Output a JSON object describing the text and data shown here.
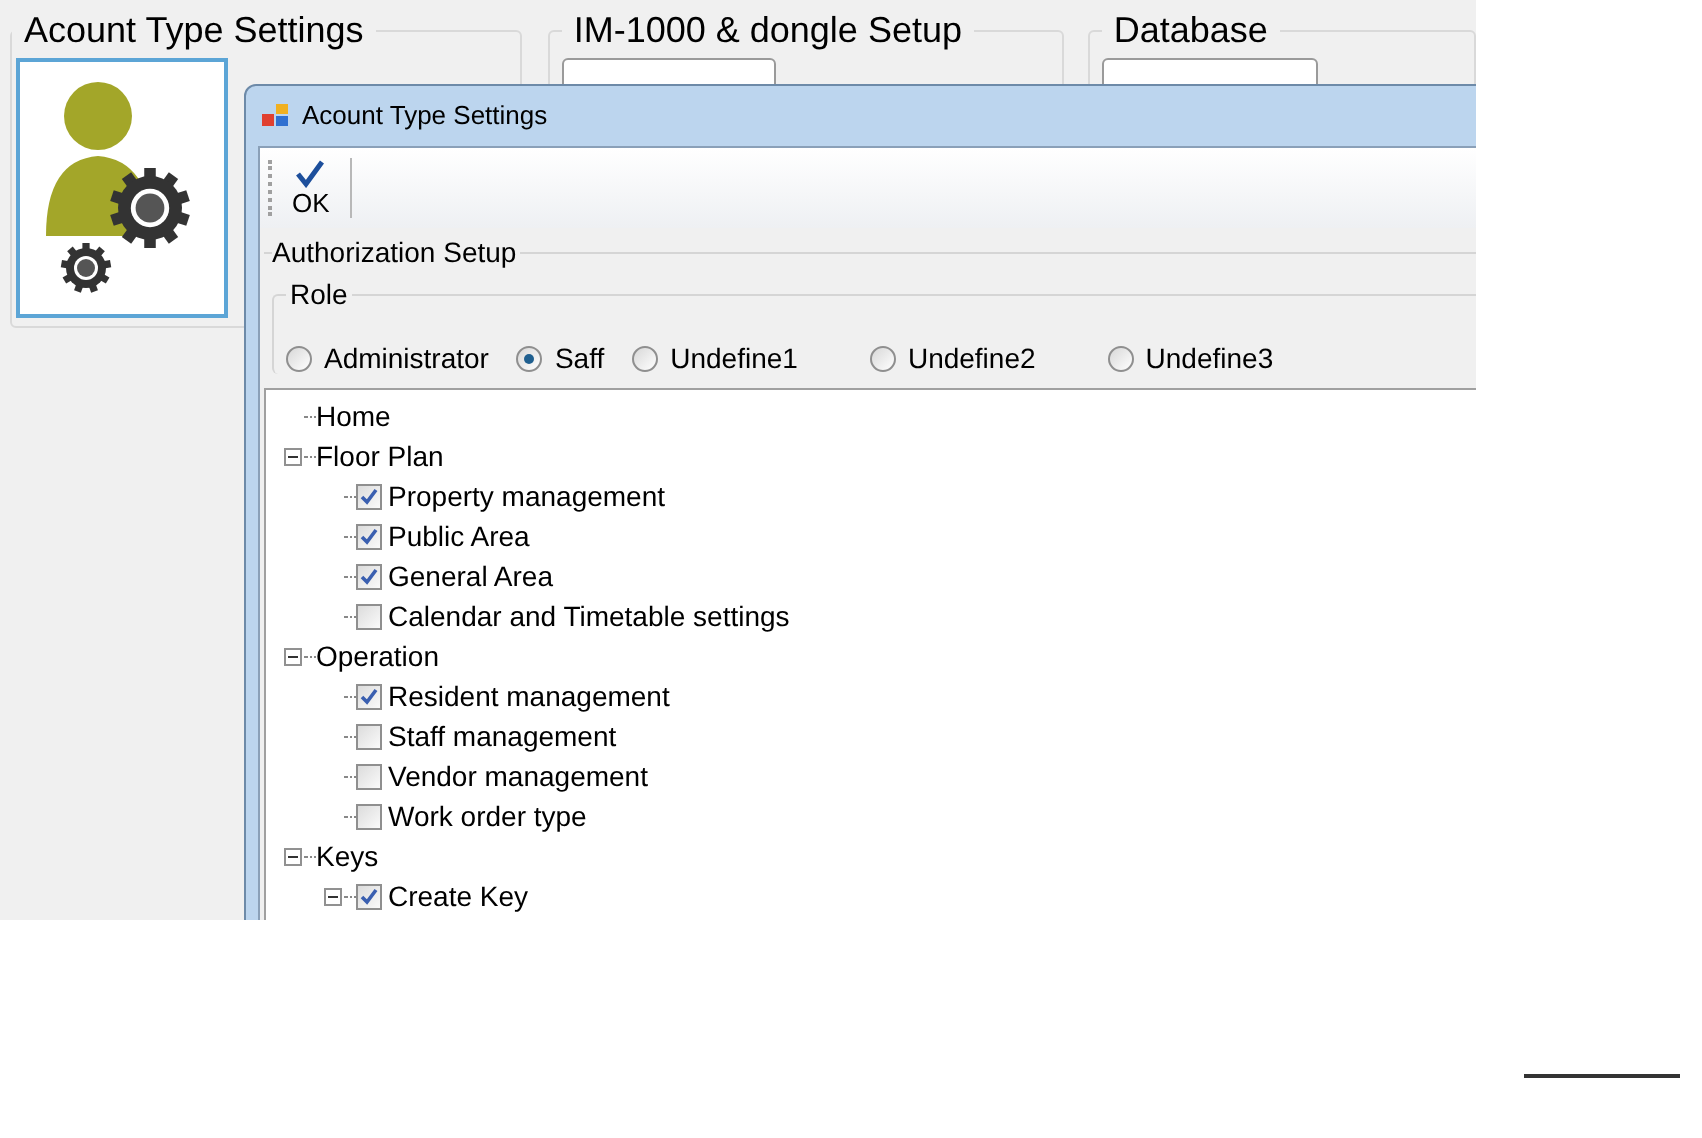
{
  "groups": [
    {
      "title": "Acount Type Settings"
    },
    {
      "title": "IM-1000 & dongle Setup"
    },
    {
      "title": "Database"
    }
  ],
  "dialog": {
    "title": "Acount Type Settings",
    "toolbar": {
      "ok": "OK"
    },
    "authorization_group": "Authorization Setup",
    "role_group": "Role",
    "roles": [
      {
        "label": "Administrator",
        "selected": false
      },
      {
        "label": "Saff",
        "selected": true
      },
      {
        "label": "Undefine1",
        "selected": false
      },
      {
        "label": "Undefine2",
        "selected": false
      },
      {
        "label": "Undefine3",
        "selected": false
      }
    ],
    "tree": [
      {
        "label": "Home"
      },
      {
        "label": "Floor Plan",
        "expanded": true,
        "children": [
          {
            "label": "Property management",
            "checked": true
          },
          {
            "label": "Public Area",
            "checked": true
          },
          {
            "label": "General Area",
            "checked": true
          },
          {
            "label": "Calendar and Timetable settings",
            "checked": false
          }
        ]
      },
      {
        "label": "Operation",
        "expanded": true,
        "children": [
          {
            "label": "Resident management",
            "checked": true
          },
          {
            "label": "Staff management",
            "checked": false
          },
          {
            "label": "Vendor management",
            "checked": false
          },
          {
            "label": "Work order type",
            "checked": false
          }
        ]
      },
      {
        "label": "Keys",
        "expanded": true,
        "children": [
          {
            "label": "Create Key",
            "checked": true,
            "expanded": true
          }
        ]
      }
    ]
  }
}
